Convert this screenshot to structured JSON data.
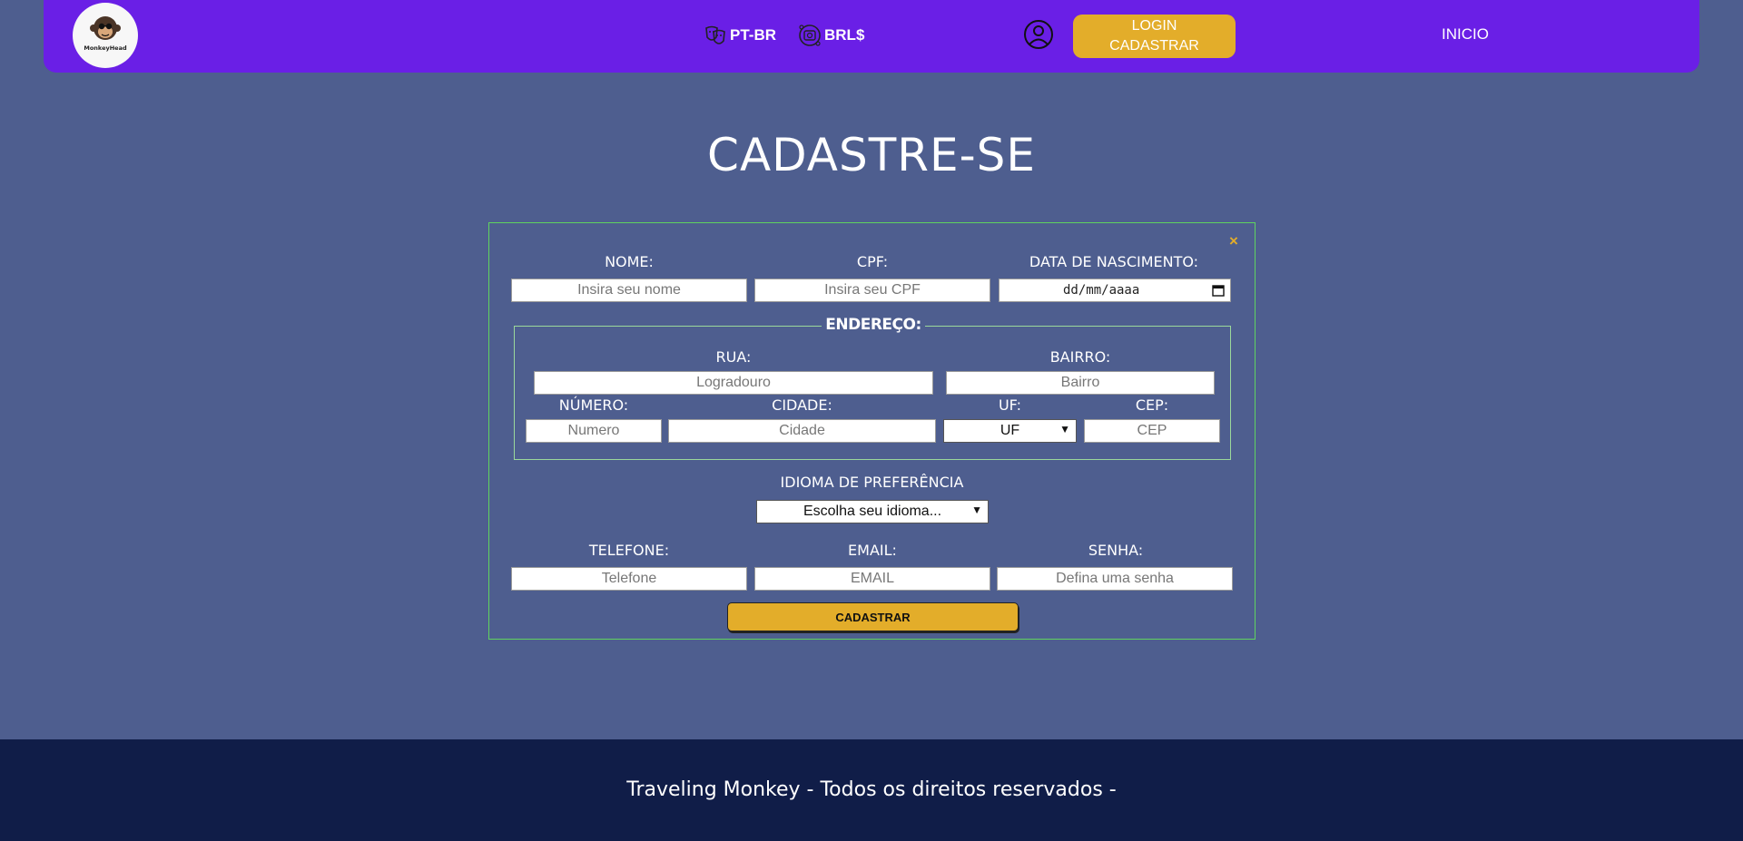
{
  "header": {
    "logo_text": "MonkeyHead",
    "language_label": "PT-BR",
    "currency_label": "BRL$",
    "login_line1": "LOGIN",
    "login_line2": "CADASTRAR",
    "inicio_label": "INICIO",
    "colors": {
      "navbar": "#6a1fe6",
      "accent": "#e3ad2a"
    }
  },
  "main": {
    "title": "CADASTRE-SE"
  },
  "form": {
    "close_icon": "×",
    "nome_label": "NOME:",
    "nome_placeholder": "Insira seu nome",
    "cpf_label": "CPF:",
    "cpf_placeholder": "Insira seu CPF",
    "nascimento_label": "DATA DE NASCIMENTO:",
    "nascimento_placeholder": "dd/mm/aaaa",
    "endereco_legend": "ENDEREÇO:",
    "rua_label": "RUA:",
    "rua_placeholder": "Logradouro",
    "bairro_label": "BAIRRO:",
    "bairro_placeholder": "Bairro",
    "numero_label": "NÚMERO:",
    "numero_placeholder": "Numero",
    "cidade_label": "CIDADE:",
    "cidade_placeholder": "Cidade",
    "uf_label": "UF:",
    "uf_selected": "UF",
    "cep_label": "CEP:",
    "cep_placeholder": "CEP",
    "idioma_label": "IDIOMA DE PREFERÊNCIA",
    "idioma_selected": "Escolha seu idioma...",
    "telefone_label": "TELEFONE:",
    "telefone_placeholder": "Telefone",
    "email_label": "EMAIL:",
    "email_placeholder": "EMAIL",
    "senha_label": "SENHA:",
    "senha_placeholder": "Defina uma senha",
    "submit_label": "CADASTRAR"
  },
  "footer": {
    "text": "Traveling Monkey - Todos os direitos reservados -"
  }
}
